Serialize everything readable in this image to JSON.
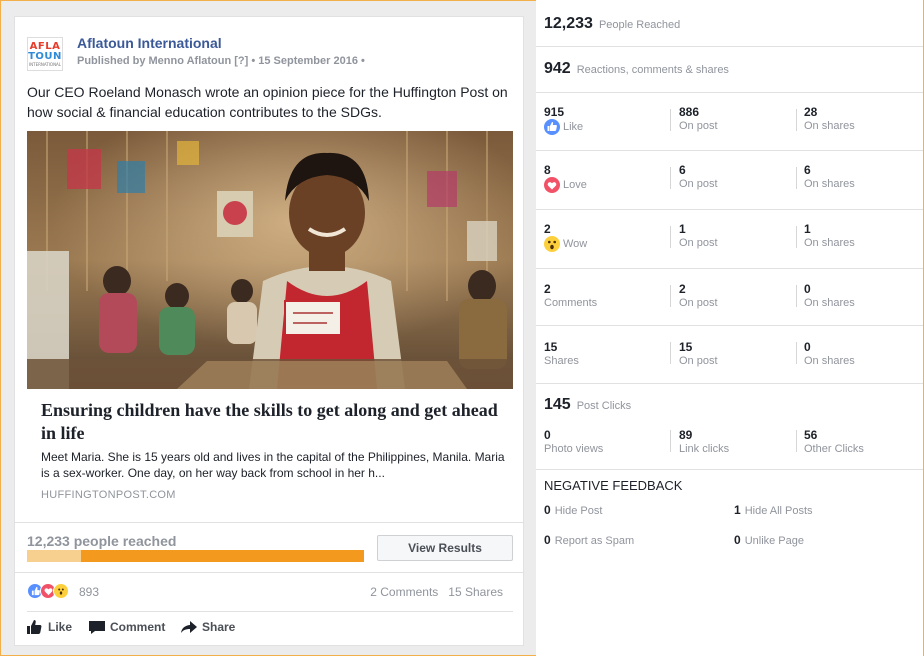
{
  "post": {
    "page_name": "Aflatoun International",
    "meta": "Published by Menno Aflatoun [?] • 15 September 2016 •",
    "logo_text": {
      "line1": "AFLA",
      "line2": "TOUN",
      "line3": "INTERNATIONAL"
    },
    "text": "Our CEO Roeland Monasch wrote an opinion piece for the Huffington Post on how social & financial education contributes to the SDGs.",
    "photo_icon": "photo-classroom-girl",
    "link": {
      "headline": "Ensuring children have the skills to get along and get ahead in life",
      "description": "Meet Maria. She is 15 years old and lives in the capital of the Philippines, Manila. Maria is a sex-worker. One day, on her way back from school in her h...",
      "domain": "HUFFINGTONPOST.COM"
    },
    "reach": {
      "label": "12,233 people reached",
      "organic_fraction": 0.84,
      "button": "View Results"
    },
    "reactions": {
      "count": "893",
      "comments": "2 Comments",
      "shares": "15 Shares"
    },
    "actions": {
      "like": "Like",
      "comment": "Comment",
      "share": "Share"
    }
  },
  "insights": {
    "reached": {
      "value": "12,233",
      "label": "People Reached"
    },
    "engagement": {
      "value": "942",
      "label": "Reactions, comments & shares"
    },
    "rows": [
      {
        "total": "915",
        "total_label": "Like",
        "icon": "like-icon",
        "on_post": "886",
        "on_post_label": "On post",
        "on_shares": "28",
        "on_shares_label": "On shares"
      },
      {
        "total": "8",
        "total_label": "Love",
        "icon": "love-icon",
        "on_post": "6",
        "on_post_label": "On post",
        "on_shares": "6",
        "on_shares_label": "On shares"
      },
      {
        "total": "2",
        "total_label": "Wow",
        "icon": "wow-icon",
        "on_post": "1",
        "on_post_label": "On post",
        "on_shares": "1",
        "on_shares_label": "On shares"
      },
      {
        "total": "2",
        "total_label": "Comments",
        "icon": "",
        "on_post": "2",
        "on_post_label": "On post",
        "on_shares": "0",
        "on_shares_label": "On shares"
      },
      {
        "total": "15",
        "total_label": "Shares",
        "icon": "",
        "on_post": "15",
        "on_post_label": "On post",
        "on_shares": "0",
        "on_shares_label": "On shares"
      }
    ],
    "clicks": {
      "value": "145",
      "label": "Post Clicks",
      "photo_views": "0",
      "photo_views_label": "Photo views",
      "link_clicks": "89",
      "link_clicks_label": "Link clicks",
      "other_clicks": "56",
      "other_clicks_label": "Other Clicks"
    },
    "negative": {
      "title": "NEGATIVE FEEDBACK",
      "items": [
        {
          "value": "0",
          "label": "Hide Post"
        },
        {
          "value": "1",
          "label": "Hide All Posts"
        },
        {
          "value": "0",
          "label": "Report as Spam"
        },
        {
          "value": "0",
          "label": "Unlike Page"
        }
      ]
    }
  },
  "colors": {
    "frame_border": "#f3b04a",
    "brand_blue": "#3b5998",
    "reach_fill": "#f39a1e",
    "reach_track": "#f7cf8f",
    "like_blue": "#5890ff",
    "love_red": "#f25268",
    "wow_yellow": "#fcd03d"
  }
}
